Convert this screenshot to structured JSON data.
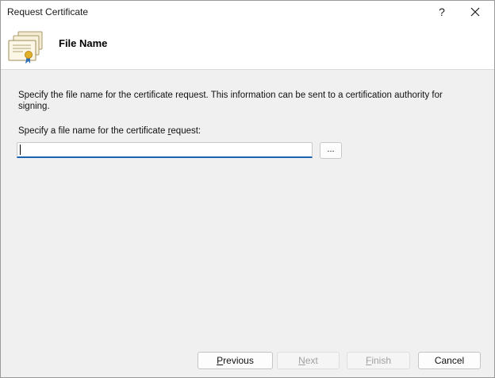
{
  "window": {
    "title": "Request Certificate",
    "help_label": "?"
  },
  "header": {
    "title": "File Name",
    "icon": "certificate-icon"
  },
  "content": {
    "description": "Specify the file name for the certificate request. This information can be sent to a certification authority for signing.",
    "field_label_before": "Specify a file name for the certificate ",
    "field_label_mnemonic": "r",
    "field_label_after": "equest:",
    "filename_value": "",
    "browse_label": "..."
  },
  "footer": {
    "previous": {
      "mnemonic": "P",
      "rest": "revious"
    },
    "next": {
      "mnemonic": "N",
      "rest": "ext"
    },
    "finish": {
      "mnemonic": "F",
      "rest": "inish"
    },
    "cancel": "Cancel"
  },
  "colors": {
    "accent": "#1a62b5",
    "dialog_bg": "#f0f0f0",
    "disabled_text": "#a0a0a0"
  }
}
